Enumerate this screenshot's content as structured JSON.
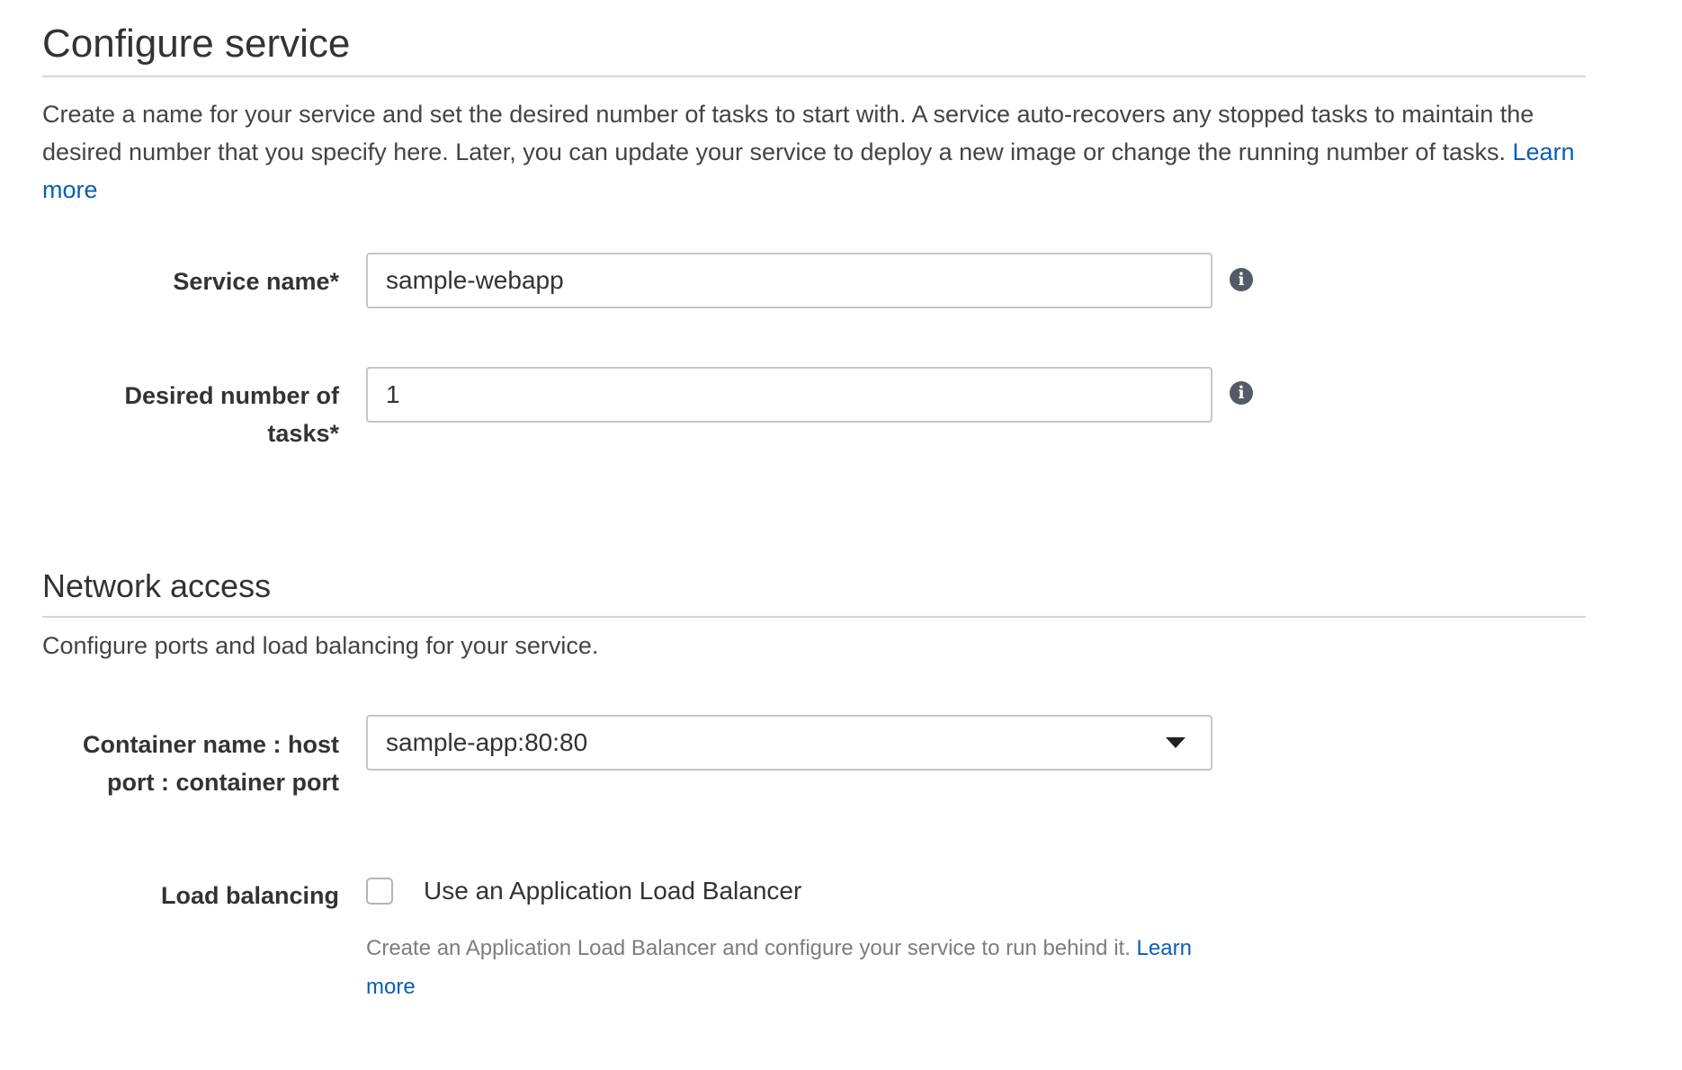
{
  "configure_service": {
    "title": "Configure service",
    "description": "Create a name for your service and set the desired number of tasks to start with. A service auto-recovers any stopped tasks to maintain the desired number that you specify here. Later, you can update your service to deploy a new image or change the running number of tasks.",
    "learn_more": "Learn more",
    "service_name": {
      "label": "Service name*",
      "value": "sample-webapp"
    },
    "desired_tasks": {
      "label": "Desired number of tasks*",
      "value": "1"
    },
    "info_glyph": "i",
    "info_icon": "info-icon"
  },
  "network_access": {
    "title": "Network access",
    "description": "Configure ports and load balancing for your service.",
    "container_port": {
      "label": "Container name : host port : container port",
      "selected": "sample-app:80:80",
      "icon": "chevron-down-icon"
    },
    "load_balancing": {
      "label": "Load balancing",
      "checkbox_label": "Use an Application Load Balancer",
      "checked": false,
      "help_text": "Create an Application Load Balancer and configure your service to run behind it.",
      "learn_more": "Learn more"
    }
  },
  "colors": {
    "link": "#0a5fb4",
    "text": "#333333",
    "border": "#c6c6c6",
    "help_text": "#7d7d7d"
  }
}
